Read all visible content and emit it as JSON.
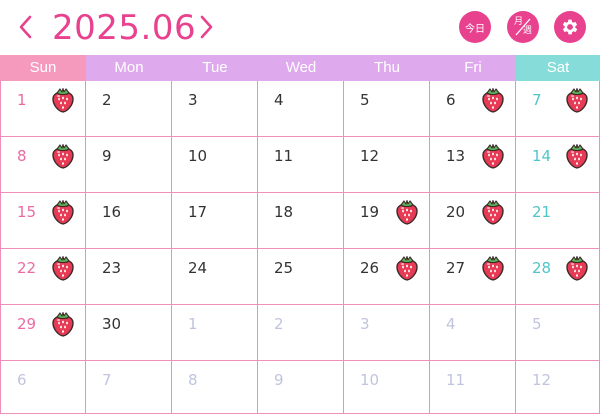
{
  "header": {
    "title": "2025.06",
    "today_label": "今日",
    "view_label_top": "月",
    "view_label_bottom": "週",
    "prev_icon": "chevron-left-icon",
    "next_icon": "chevron-right-icon",
    "settings_icon": "gear-icon"
  },
  "colors": {
    "accent": "#e8428f",
    "sunday": "#f59abd",
    "weekday": "#dfa9ee",
    "saturday": "#85dcd8",
    "grid": "#ef8fbb"
  },
  "weekdays": [
    "Sun",
    "Mon",
    "Tue",
    "Wed",
    "Thu",
    "Fri",
    "Sat"
  ],
  "weeks": [
    [
      {
        "day": "1",
        "berry": true
      },
      {
        "day": "2"
      },
      {
        "day": "3"
      },
      {
        "day": "4"
      },
      {
        "day": "5"
      },
      {
        "day": "6",
        "berry": true
      },
      {
        "day": "7",
        "berry": true
      }
    ],
    [
      {
        "day": "8",
        "berry": true
      },
      {
        "day": "9"
      },
      {
        "day": "10"
      },
      {
        "day": "11"
      },
      {
        "day": "12"
      },
      {
        "day": "13",
        "berry": true
      },
      {
        "day": "14",
        "berry": true
      }
    ],
    [
      {
        "day": "15",
        "berry": true
      },
      {
        "day": "16"
      },
      {
        "day": "17"
      },
      {
        "day": "18"
      },
      {
        "day": "19",
        "berry": true
      },
      {
        "day": "20",
        "berry": true
      },
      {
        "day": "21"
      }
    ],
    [
      {
        "day": "22",
        "berry": true
      },
      {
        "day": "23"
      },
      {
        "day": "24"
      },
      {
        "day": "25"
      },
      {
        "day": "26",
        "berry": true
      },
      {
        "day": "27",
        "berry": true
      },
      {
        "day": "28",
        "berry": true
      }
    ],
    [
      {
        "day": "29",
        "berry": true
      },
      {
        "day": "30"
      },
      {
        "day": "1",
        "other": true
      },
      {
        "day": "2",
        "other": true
      },
      {
        "day": "3",
        "other": true
      },
      {
        "day": "4",
        "other": true
      },
      {
        "day": "5",
        "other": true
      }
    ],
    [
      {
        "day": "6",
        "other": true
      },
      {
        "day": "7",
        "other": true
      },
      {
        "day": "8",
        "other": true
      },
      {
        "day": "9",
        "other": true
      },
      {
        "day": "10",
        "other": true
      },
      {
        "day": "11",
        "other": true
      },
      {
        "day": "12",
        "other": true
      }
    ]
  ],
  "stamp_icon": "strawberry-icon"
}
